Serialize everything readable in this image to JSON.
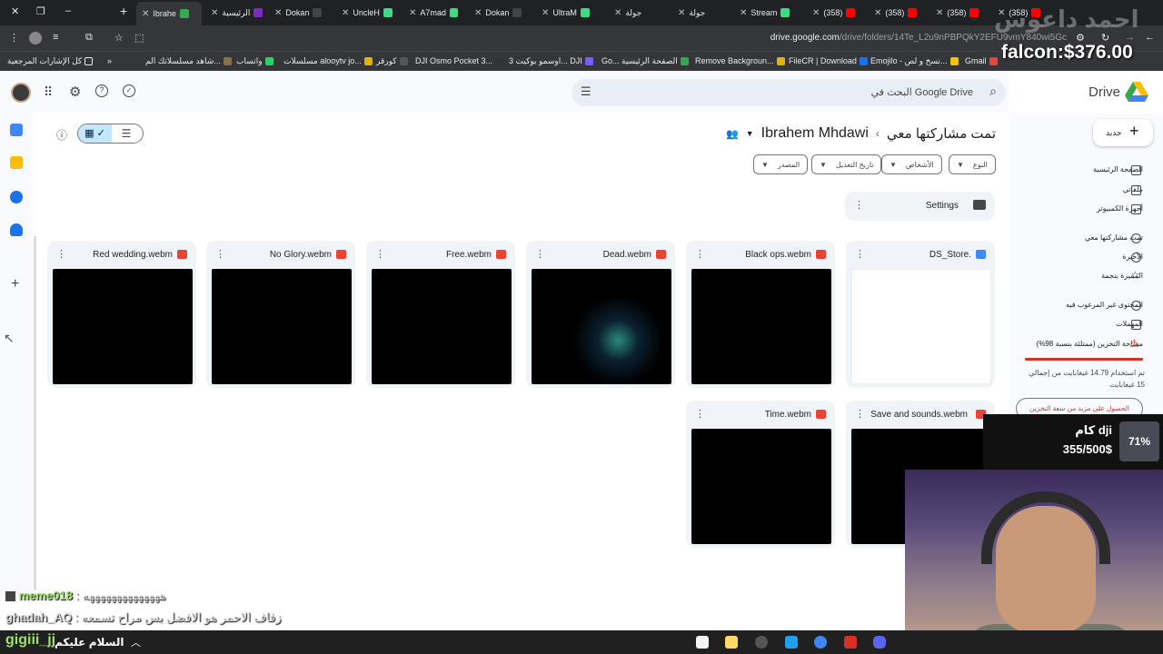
{
  "browser": {
    "tabs": [
      {
        "label": "Ibrahe",
        "active": true
      },
      {
        "label": "الرئيسية"
      },
      {
        "label": "Dokan"
      },
      {
        "label": "UncleH"
      },
      {
        "label": "A7mad"
      },
      {
        "label": "Dokan"
      },
      {
        "label": "UltraM"
      },
      {
        "label": "جولة"
      },
      {
        "label": "جولة"
      },
      {
        "label": "Stream"
      },
      {
        "label": "(358)"
      },
      {
        "label": "(358)"
      },
      {
        "label": "(358)"
      },
      {
        "label": "(358)"
      }
    ],
    "url_host": "drive.google.com",
    "url_path": "/drive/folders/14Te_L2u9nPBPQkY2EFU9vmY840wi5Gc",
    "bookmarks": [
      "كل الإشارات المرجعية",
      "شاهد مسلسلاتك الم...",
      "واتساب",
      "مسلسلات alooytv jo...",
      "كورقر",
      "DJI Osmo Pocket 3...",
      "اوسمو بوكيت 3... DJI",
      "Go... الصفحة الرئيسية",
      "Remove Backgroun...",
      "FileCR | Download",
      "Emojilo - نسخ و لص...",
      "Gmail"
    ]
  },
  "drive": {
    "logo_text": "Drive",
    "search_placeholder": "البحث في Google Drive",
    "new_label": "جديد",
    "breadcrumb": {
      "root": "تمت مشاركتها معي",
      "owner": "Ibrahem Mhdawi"
    },
    "filters": [
      "النوع",
      "الأشخاص",
      "تاريخ التعديل",
      "المصدر"
    ],
    "folder": {
      "name": "Settings"
    },
    "files": [
      {
        "name": "Red wedding.webm",
        "type": "video"
      },
      {
        "name": "No Glory.webm",
        "type": "video"
      },
      {
        "name": "Free.webm",
        "type": "video"
      },
      {
        "name": "Dead.webm",
        "type": "video"
      },
      {
        "name": "Black ops.webm",
        "type": "video"
      },
      {
        "name": "DS_Store.",
        "type": "doc"
      },
      {
        "name": "Time.webm",
        "type": "video"
      },
      {
        "name": "Save and sounds.webm",
        "type": "video"
      }
    ],
    "sidebar": {
      "items": [
        {
          "label": "الصفحة الرئيسية",
          "icon": "home-icon"
        },
        {
          "label": "ملفاتي",
          "icon": "my-drive-icon"
        },
        {
          "label": "أجهزة الكمبيوتر",
          "icon": "computer-icon"
        },
        {
          "label": "تمت مشاركتها معي",
          "icon": "shared-icon"
        },
        {
          "label": "الأخيرة",
          "icon": "clock-icon"
        },
        {
          "label": "المميزة بنجمة",
          "icon": "star-icon"
        },
        {
          "label": "المحتوى غير المرغوب فيه",
          "icon": "spam-icon"
        },
        {
          "label": "المهملات",
          "icon": "trash-icon"
        },
        {
          "label": "مساحة التخزين (ممتلئة بنسبة 98%)",
          "icon": "warning-icon"
        }
      ],
      "storage_used": "تم استخدام 14.79 غيغابايت من إجمالي 15 غيغابايت",
      "storage_fraction": 0.98,
      "get_more": "الحصول على مزيد من سعة التخزين"
    }
  },
  "overlay": {
    "watermark": "احمد داعوس",
    "falcon": "falcon:$376.00",
    "dji_title": "كام dji",
    "dji_progress": "355/500$",
    "dji_percent": "71%",
    "chat": [
      {
        "user": "meme018",
        "msg": "ههههههههههههههه"
      },
      {
        "user": "ghadah_AQ",
        "msg": "زفاف الاحمر هو الافضل بس مراح تسمعه"
      }
    ],
    "bottom_user": "gigiii_jj",
    "bottom_msg": "السلام عليكم"
  }
}
